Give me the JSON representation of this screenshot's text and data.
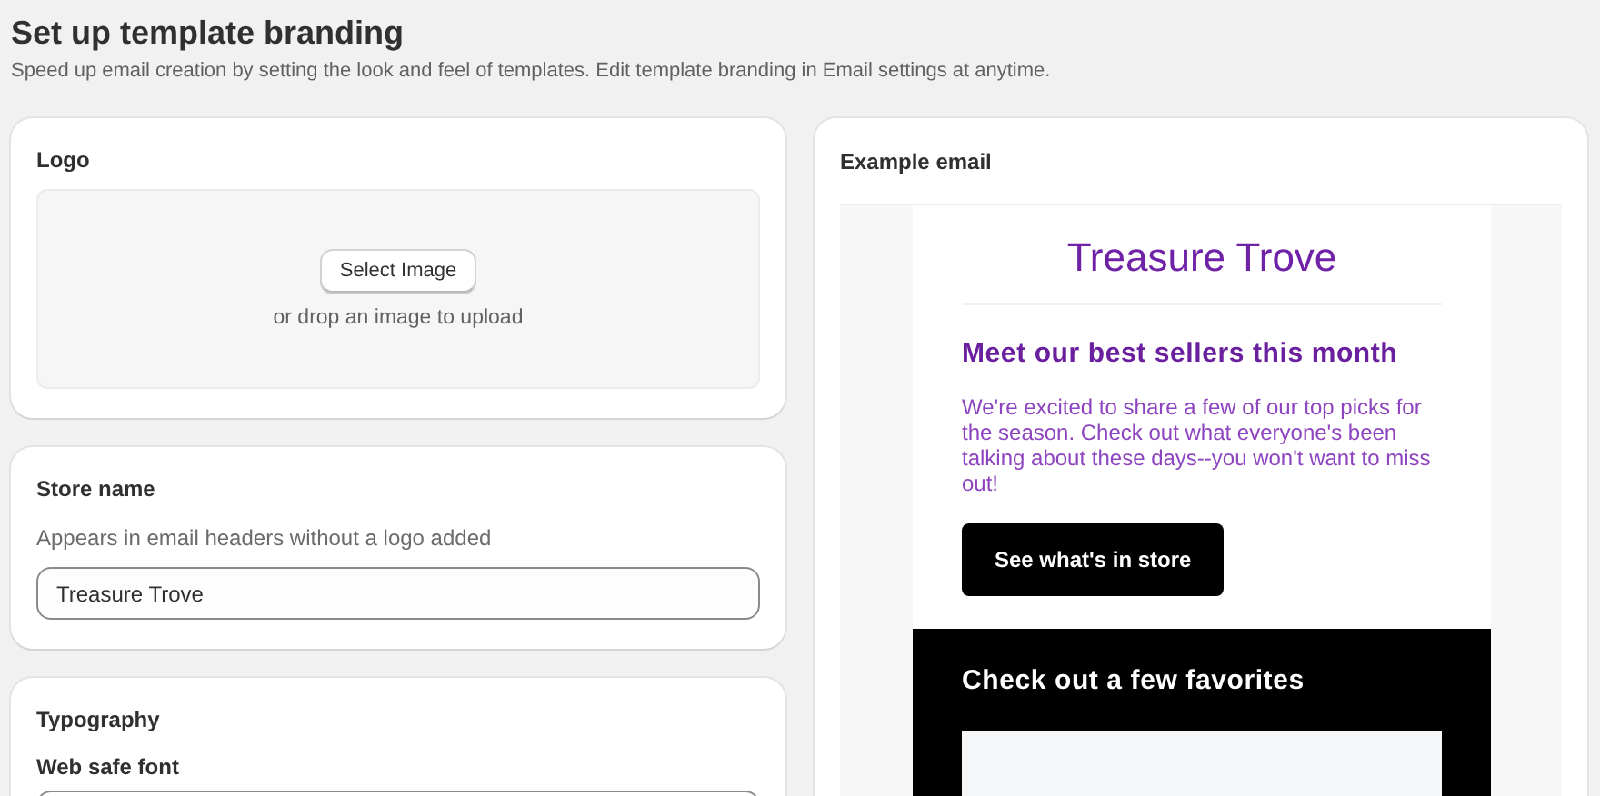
{
  "page": {
    "title": "Set up template branding",
    "subtitle": "Speed up email creation by setting the look and feel of templates. Edit template branding in Email settings at anytime."
  },
  "logo": {
    "heading": "Logo",
    "button": "Select Image",
    "hint": "or drop an image to upload"
  },
  "store_name": {
    "heading": "Store name",
    "help": "Appears in email headers without a logo added",
    "value": "Treasure Trove"
  },
  "typography": {
    "heading": "Typography",
    "font_label": "Web safe font"
  },
  "example_email": {
    "heading": "Example email",
    "store_name": "Treasure Trove",
    "headline": "Meet our best sellers this month",
    "body": "We're excited to share a few of our top picks for the season. Check out what everyone's been talking about these days--you won't want to miss out!",
    "button": "See what's in store",
    "section_heading": "Check out a few favorites"
  }
}
